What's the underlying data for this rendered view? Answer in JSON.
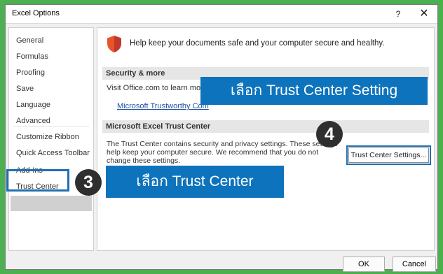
{
  "window": {
    "title": "Excel Options",
    "help_label": "?",
    "close_label": "✕"
  },
  "sidebar": {
    "items": [
      {
        "label": "General"
      },
      {
        "label": "Formulas"
      },
      {
        "label": "Proofing"
      },
      {
        "label": "Save"
      },
      {
        "label": "Language"
      },
      {
        "label": "Advanced"
      },
      {
        "label": "Customize Ribbon"
      },
      {
        "label": "Quick Access Toolbar"
      },
      {
        "label": "Add-Ins"
      },
      {
        "label": "Trust Center"
      }
    ],
    "selected": "Trust Center"
  },
  "main": {
    "intro_text": "Help keep your documents safe and your computer secure and healthy.",
    "security": {
      "heading": "Security & more",
      "text": "Visit Office.com to learn more",
      "link": "Microsoft Trustworthy Com"
    },
    "trust_center": {
      "heading": "Microsoft Excel Trust Center",
      "description": "The Trust Center contains security and privacy settings. These settings help keep your computer secure. We recommend that you do not change these settings.",
      "button_label": "Trust Center Settings..."
    }
  },
  "footer": {
    "ok_label": "OK",
    "cancel_label": "Cancel"
  },
  "annotations": {
    "step3_badge": "3",
    "step3_text": "เลือก Trust Center",
    "step4_badge": "4",
    "step4_text": "เลือก Trust Center Setting"
  },
  "colors": {
    "frame_green": "#4caf50",
    "callout_blue": "#0d73bc",
    "badge_dark": "#2f2f2f",
    "link_blue": "#1f4e9c",
    "shield_orange": "#e8542a"
  }
}
